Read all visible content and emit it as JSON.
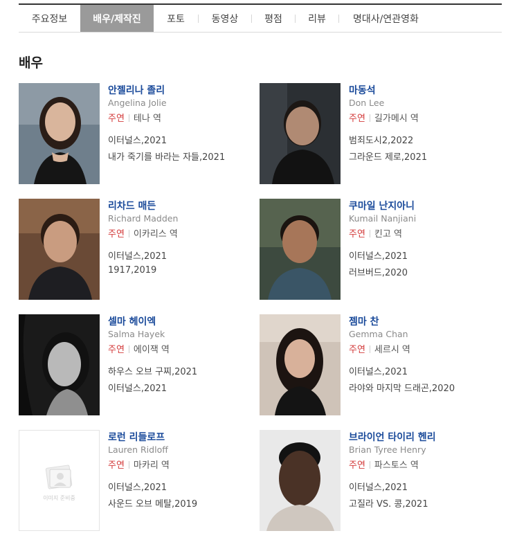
{
  "tabs": [
    {
      "label": "주요정보",
      "active": false
    },
    {
      "label": "배우/제작진",
      "active": true
    },
    {
      "label": "포토",
      "active": false
    },
    {
      "label": "동영상",
      "active": false
    },
    {
      "label": "평점",
      "active": false
    },
    {
      "label": "리뷰",
      "active": false
    },
    {
      "label": "명대사/연관영화",
      "active": false
    }
  ],
  "section_title": "배우",
  "actors": [
    {
      "name": "안젤리나 졸리",
      "ename": "Angelina Jolie",
      "role_type": "주연",
      "role": "테나 역",
      "films": [
        "이터널스,2021",
        "내가 죽기를 바라는 자들,2021"
      ]
    },
    {
      "name": "마동석",
      "ename": "Don Lee",
      "role_type": "주연",
      "role": "길가메시 역",
      "films": [
        "범죄도시2,2022",
        "그라운드 제로,2021"
      ]
    },
    {
      "name": "리차드 매든",
      "ename": "Richard Madden",
      "role_type": "주연",
      "role": "이카리스 역",
      "films": [
        "이터널스,2021",
        "1917,2019"
      ]
    },
    {
      "name": "쿠마일 난지아니",
      "ename": "Kumail Nanjiani",
      "role_type": "주연",
      "role": "킨고 역",
      "films": [
        "이터널스,2021",
        "러브버드,2020"
      ]
    },
    {
      "name": "셀마 헤이엑",
      "ename": "Salma Hayek",
      "role_type": "주연",
      "role": "에이잭 역",
      "films": [
        "하우스 오브 구찌,2021",
        "이터널스,2021"
      ]
    },
    {
      "name": "젬마 찬",
      "ename": "Gemma Chan",
      "role_type": "주연",
      "role": "세르시 역",
      "films": [
        "이터널스,2021",
        "라야와 마지막 드래곤,2020"
      ]
    },
    {
      "name": "로런 리들로프",
      "ename": "Lauren Ridloff",
      "role_type": "주연",
      "role": "마카리 역",
      "films": [
        "이터널스,2021",
        "사운드 오브 메탈,2019"
      ],
      "photo_placeholder": "이미지 준비중"
    },
    {
      "name": "브라이언 타이리 헨리",
      "ename": "Brian Tyree Henry",
      "role_type": "주연",
      "role": "파스토스 역",
      "films": [
        "이터널스,2021",
        "고질라 VS. 콩,2021"
      ]
    }
  ],
  "colors": {
    "actor_name": "#1a4a9a",
    "role_type": "#d33a3a",
    "active_tab_bg": "#9a9a9a"
  }
}
